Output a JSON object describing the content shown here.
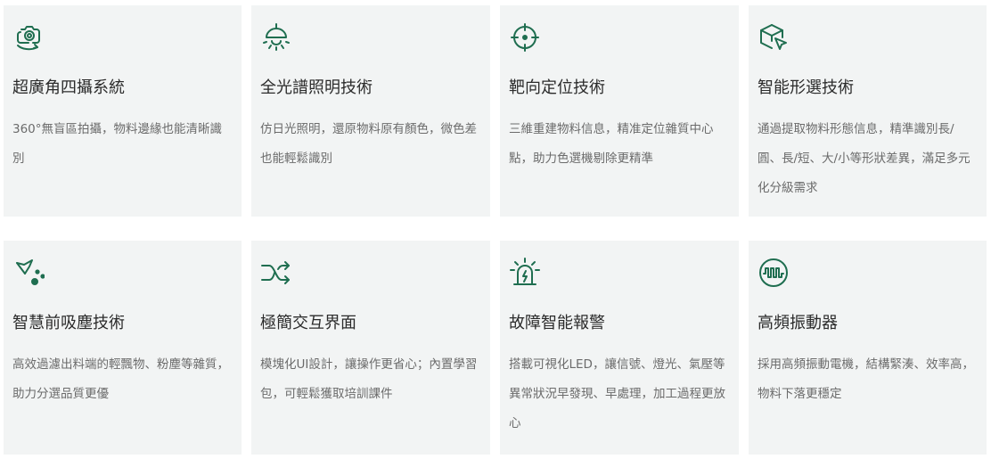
{
  "accent": "#1f6e50",
  "cards": [
    {
      "icon": "camera-rotate-icon",
      "title": "超廣角四攝系統",
      "desc": "360°無盲區拍攝，物料邊緣也能清晰識別"
    },
    {
      "icon": "ceiling-lamp-icon",
      "title": "全光譜照明技術",
      "desc": "仿日光照明，還原物料原有顏色，微色差也能輕鬆識別"
    },
    {
      "icon": "crosshair-target-icon",
      "title": "靶向定位技術",
      "desc": "三維重建物料信息，精准定位雜質中心點，助力色選機剔除更精準"
    },
    {
      "icon": "cube-cursor-icon",
      "title": "智能形選技術",
      "desc": "通過提取物料形態信息，精準識別長/圓、長/短、大/小等形狀差異，滿足多元化分級需求"
    },
    {
      "icon": "dust-removal-icon",
      "title": "智慧前吸塵技術",
      "desc": "高效過濾出料端的輕飄物、粉塵等雜質，助力分選品質更優"
    },
    {
      "icon": "shuffle-arrows-icon",
      "title": "極簡交互界面",
      "desc": "模塊化UI設計，讓操作更省心；內置學習包，可輕鬆獲取培訓課件"
    },
    {
      "icon": "alarm-light-icon",
      "title": "故障智能報警",
      "desc": "搭載可視化LED，讓信號、燈光、氣壓等異常狀況早發現、早處理，加工過程更放心"
    },
    {
      "icon": "vibration-wave-icon",
      "title": "高頻振動器",
      "desc": "採用高頻振動電機，結構緊湊、效率高，物料下落更穩定"
    }
  ]
}
